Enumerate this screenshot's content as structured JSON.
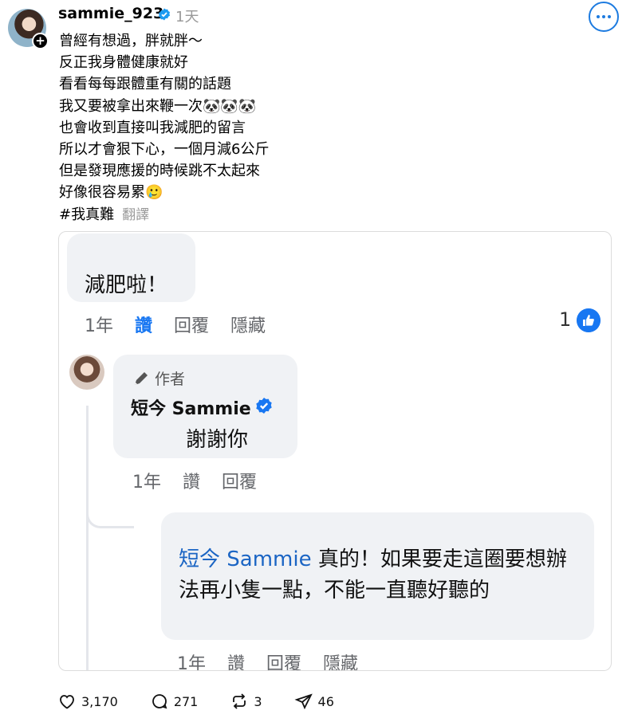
{
  "post": {
    "username": "sammie_923",
    "timestamp": "1天",
    "lines": [
      "曾經有想過，胖就胖～",
      "反正我身體健康就好",
      "看看每每跟體重有關的話題",
      "我又要被拿出來鞭一次🐼🐼🐼",
      "也會收到直接叫我減肥的留言",
      "所以才會狠下心，一個月減6公斤",
      "但是發現應援的時候跳不太起來",
      "好像很容易累🥲"
    ],
    "hashtag": "#我真難",
    "translate_label": "翻譯"
  },
  "comment": {
    "text": "減肥啦！",
    "time": "1年",
    "like_label": "讚",
    "reply_label": "回覆",
    "hide_label": "隱藏",
    "like_count": "1"
  },
  "reply": {
    "author_badge": "作者",
    "author_name": "短今 Sammie",
    "text": "謝謝你",
    "time": "1年",
    "like_label": "讚",
    "reply_label": "回覆"
  },
  "reply2": {
    "mention": "短今 Sammie",
    "text": " 真的！如果要走這圈要想辦法再小隻一點，不能一直聽好聽的",
    "time": "1年",
    "like_label": "讚",
    "reply_label": "回覆",
    "hide_label": "隱藏"
  },
  "actions": {
    "likes": "3,170",
    "comments": "271",
    "reposts": "3",
    "shares": "46"
  },
  "colors": {
    "accent": "#1877f2",
    "more_button": "#1d7be0",
    "bubble": "#f0f2f5"
  }
}
